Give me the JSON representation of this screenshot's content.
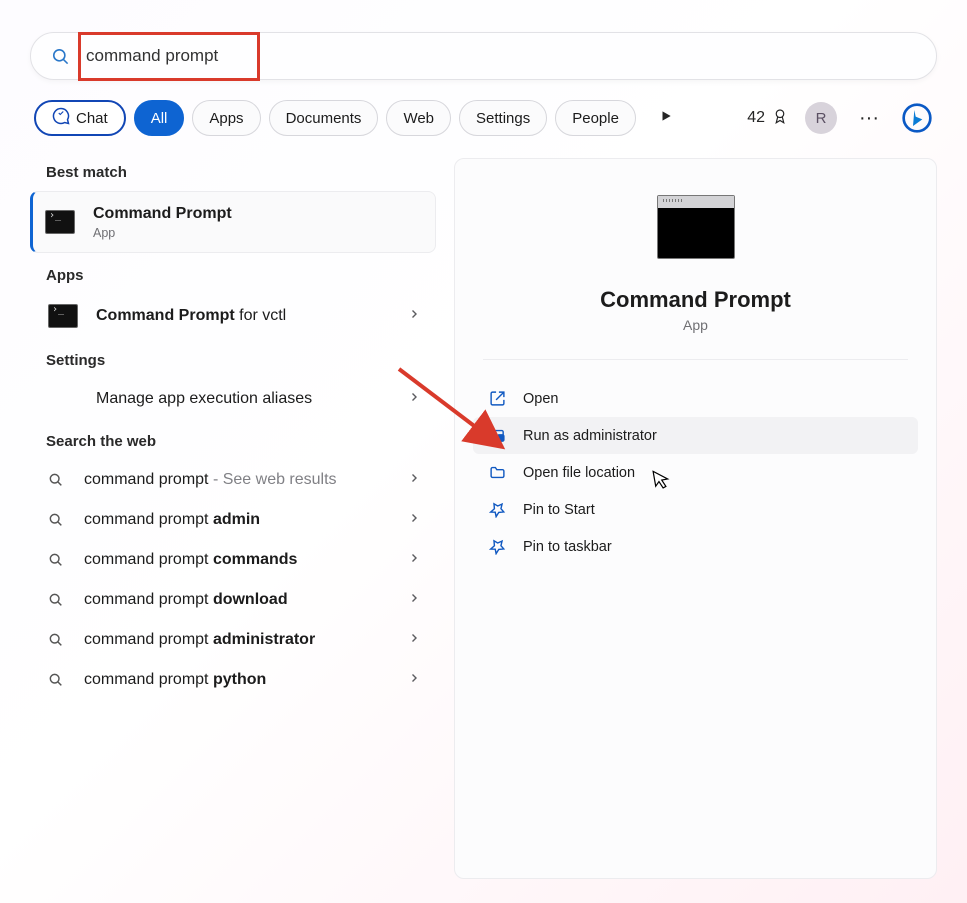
{
  "search": {
    "value": "command prompt"
  },
  "tabs": {
    "chat": "Chat",
    "all": "All",
    "apps": "Apps",
    "documents": "Documents",
    "web": "Web",
    "settings": "Settings",
    "people": "People"
  },
  "header": {
    "xp_count": "42",
    "avatar_initial": "R"
  },
  "sections": {
    "best_match": "Best match",
    "apps": "Apps",
    "settings": "Settings",
    "search_web": "Search the web"
  },
  "best_match": {
    "title": "Command Prompt",
    "subtitle": "App"
  },
  "apps_results": [
    {
      "bold": "Command Prompt",
      "rest": " for vctl"
    }
  ],
  "settings_results": [
    {
      "label": "Manage app execution aliases"
    }
  ],
  "web_results": [
    {
      "prefix": "command prompt",
      "bold": "",
      "suffix": " - See web results",
      "suffix_muted": true
    },
    {
      "prefix": "command prompt ",
      "bold": "admin",
      "suffix": ""
    },
    {
      "prefix": "command prompt ",
      "bold": "commands",
      "suffix": ""
    },
    {
      "prefix": "command prompt ",
      "bold": "download",
      "suffix": ""
    },
    {
      "prefix": "command prompt ",
      "bold": "administrator",
      "suffix": ""
    },
    {
      "prefix": "command prompt ",
      "bold": "python",
      "suffix": ""
    }
  ],
  "preview": {
    "title": "Command Prompt",
    "subtitle": "App"
  },
  "actions": {
    "open": "Open",
    "run_admin": "Run as administrator",
    "open_loc": "Open file location",
    "pin_start": "Pin to Start",
    "pin_taskbar": "Pin to taskbar"
  }
}
